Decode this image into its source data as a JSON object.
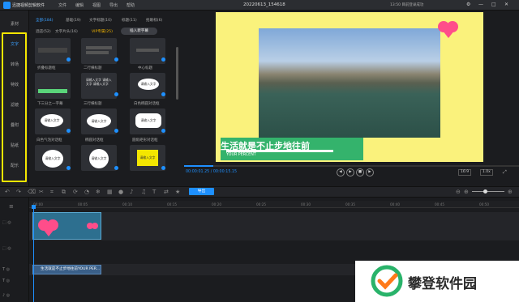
{
  "titlebar": {
    "app_name": "迅捷视频剪辑软件",
    "menus": [
      "文件",
      "编辑",
      "视图",
      "导出",
      "帮助"
    ],
    "file_title": "20220613_154618",
    "login": "13:50 目前登录成功",
    "window_controls": [
      "⚙",
      "—",
      "□",
      "✕"
    ]
  },
  "nav": {
    "items": [
      "素材",
      "文字",
      "转场",
      "特效",
      "滤镜",
      "叠附",
      "贴纸",
      "配乐"
    ]
  },
  "panel": {
    "tabs_row1": [
      "全部(184)",
      "基础(19)",
      "文字标题(10)",
      "标题(11)",
      "抢眼标(6)"
    ],
    "tabs_row2": [
      "酒店(52)",
      "文字片头(16)",
      "VIP专属(25)"
    ],
    "insert_button": "插入新字幕",
    "thumbs": [
      {
        "label": "折叠标题框",
        "text": ""
      },
      {
        "label": "二行横标题",
        "text": ""
      },
      {
        "label": "中心标题",
        "text": ""
      },
      {
        "label": "下三分之一字幕",
        "text": ""
      },
      {
        "label": "三行横标题",
        "text": "请输入文字 请输入文字 请输入文字"
      },
      {
        "label": "白色椭圆对话框",
        "text": "请输入文字"
      },
      {
        "label": "白色气泡对话框",
        "text": "请输入文字"
      },
      {
        "label": "椭圆对话框",
        "text": "请输入文字"
      },
      {
        "label": "圆角矩形对话框",
        "text": "请输入文字"
      },
      {
        "label": "",
        "text": "请输入文字"
      },
      {
        "label": "",
        "text": "请输入文字"
      },
      {
        "label": "",
        "text": "请输入文字"
      }
    ]
  },
  "preview": {
    "overlay_title": "生活就是不止步地往前",
    "overlay_subtitle": "YOUR PERCENT",
    "time": "00:00:01.25 / 00:00:15.15",
    "speed": "16:9",
    "zoom": "1.0x",
    "progress": 0.09
  },
  "toolbar": {
    "export": "导出"
  },
  "timeline": {
    "ticks": [
      "00:00",
      "00:05",
      "00:10",
      "00:15",
      "00:20",
      "00:25",
      "00:30",
      "00:35",
      "00:40",
      "00:45",
      "00:50"
    ],
    "text_clip": "生活就是不止步地往前YOUR PER..."
  },
  "watermark": {
    "text": "攀登软件园"
  },
  "colors": {
    "accent": "#1e90ff",
    "highlight": "#f4e600",
    "canvas_bg": "#faf27c",
    "green": "#34b36c"
  }
}
